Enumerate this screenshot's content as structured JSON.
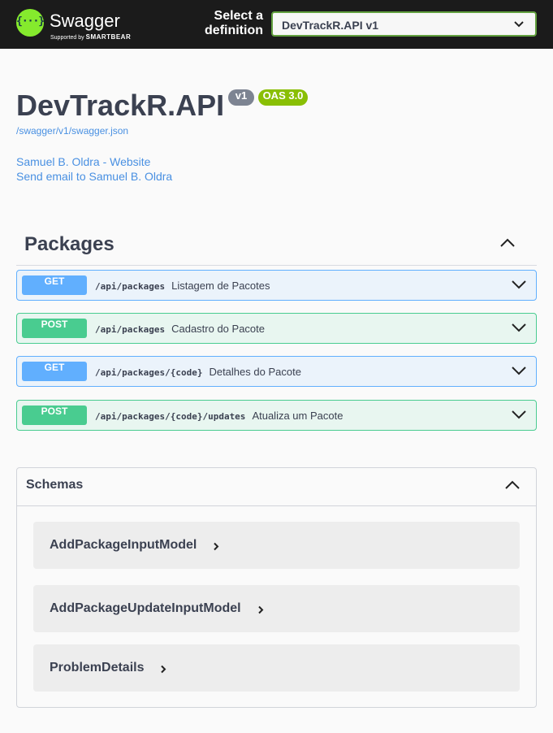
{
  "topbar": {
    "logo_text": "Swagger",
    "logo_sub_prefix": "Supported by",
    "logo_sub_brand": "SMARTBEAR",
    "logo_glyph": "{···}",
    "select_label": "Select a definition",
    "selected_definition": "DevTrackR.API v1"
  },
  "info": {
    "title": "DevTrackR.API",
    "version_badge": "v1",
    "oas_badge": "OAS 3.0",
    "spec_url": "/swagger/v1/swagger.json",
    "website_link": "Samuel B. Oldra - Website",
    "email_link": "Send email to Samuel B. Oldra"
  },
  "tag": {
    "name": "Packages"
  },
  "operations": [
    {
      "method": "GET",
      "path": "/api/packages",
      "summary": "Listagem de Pacotes"
    },
    {
      "method": "POST",
      "path": "/api/packages",
      "summary": "Cadastro do Pacote"
    },
    {
      "method": "GET",
      "path": "/api/packages/{code}",
      "summary": "Detalhes do Pacote"
    },
    {
      "method": "POST",
      "path": "/api/packages/{code}/updates",
      "summary": "Atualiza um Pacote"
    }
  ],
  "schemas": {
    "title": "Schemas",
    "models": [
      "AddPackageInputModel",
      "AddPackageUpdateInputModel",
      "ProblemDetails"
    ]
  },
  "colors": {
    "get": "#61affe",
    "post": "#49cc90",
    "topbar": "#1b1b1b",
    "link": "#4990e2"
  },
  "icons": [
    "swagger-logo-icon",
    "chevron-down-icon",
    "chevron-up-icon",
    "chevron-right-icon"
  ]
}
